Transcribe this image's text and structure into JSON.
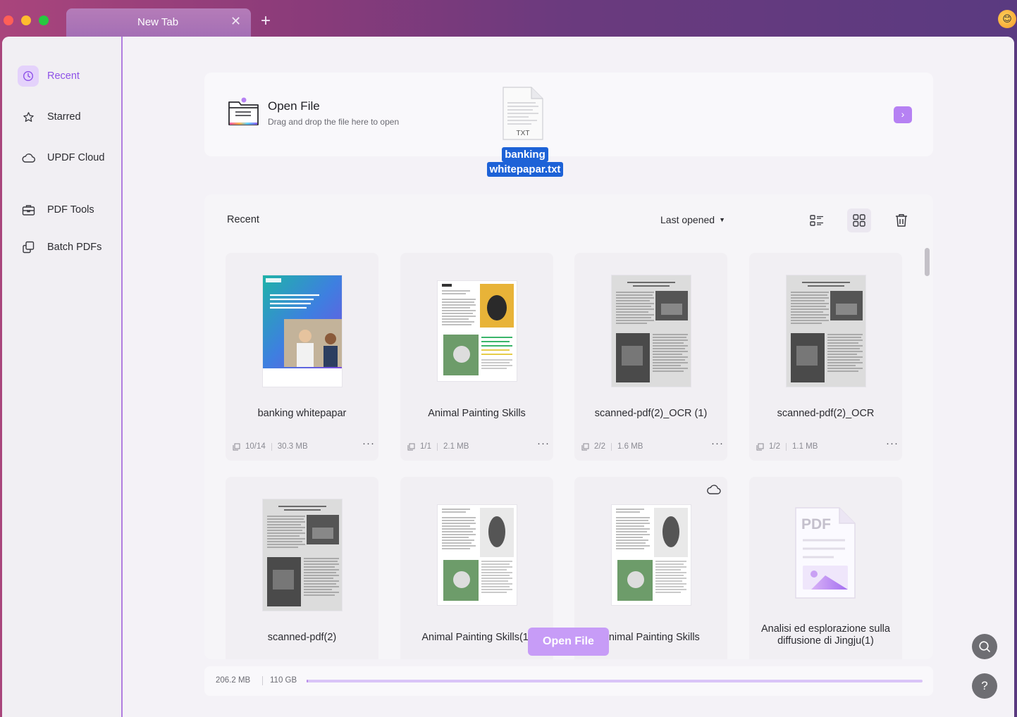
{
  "browser": {
    "tab_title": "New Tab",
    "tab_close": "✕",
    "new_tab": "+"
  },
  "sidebar": {
    "items": [
      {
        "label": "Recent",
        "icon": "clock-icon",
        "active": true
      },
      {
        "label": "Starred",
        "icon": "star-icon"
      },
      {
        "label": "UPDF Cloud",
        "icon": "cloud-icon"
      },
      {
        "label": "PDF Tools",
        "icon": "toolbox-icon"
      },
      {
        "label": "Batch PDFs",
        "icon": "batch-icon"
      }
    ]
  },
  "open_file": {
    "title": "Open File",
    "subtitle": "Drag and drop the file here to open",
    "arrow": "›"
  },
  "dragged_file": {
    "ext": "TXT",
    "name_line1": "banking",
    "name_line2": "whitepapar.txt"
  },
  "recent": {
    "heading": "Recent",
    "sort_label": "Last opened",
    "files": [
      {
        "name": "banking whitepapar",
        "pages": "10/14",
        "size": "30.3 MB"
      },
      {
        "name": "Animal Painting Skills",
        "pages": "1/1",
        "size": "2.1 MB"
      },
      {
        "name": "scanned-pdf(2)_OCR (1)",
        "pages": "2/2",
        "size": "1.6 MB"
      },
      {
        "name": "scanned-pdf(2)_OCR",
        "pages": "1/2",
        "size": "1.1 MB"
      },
      {
        "name": "scanned-pdf(2)"
      },
      {
        "name": "Animal Painting Skills(1)"
      },
      {
        "name": "Animal Painting Skills",
        "cloud": true
      },
      {
        "name": "Analisi ed esplorazione sulla diffusione di Jingju(1)",
        "ext": "PDF"
      }
    ],
    "more": "···"
  },
  "open_button": "Open File",
  "storage": {
    "used": "206.2 MB",
    "total": "110 GB",
    "used_fraction": 0.002
  },
  "help": "?",
  "colors": {
    "accent": "#8e52e8",
    "accent_light": "#b681f3",
    "drag_label": "#1d62d7"
  }
}
